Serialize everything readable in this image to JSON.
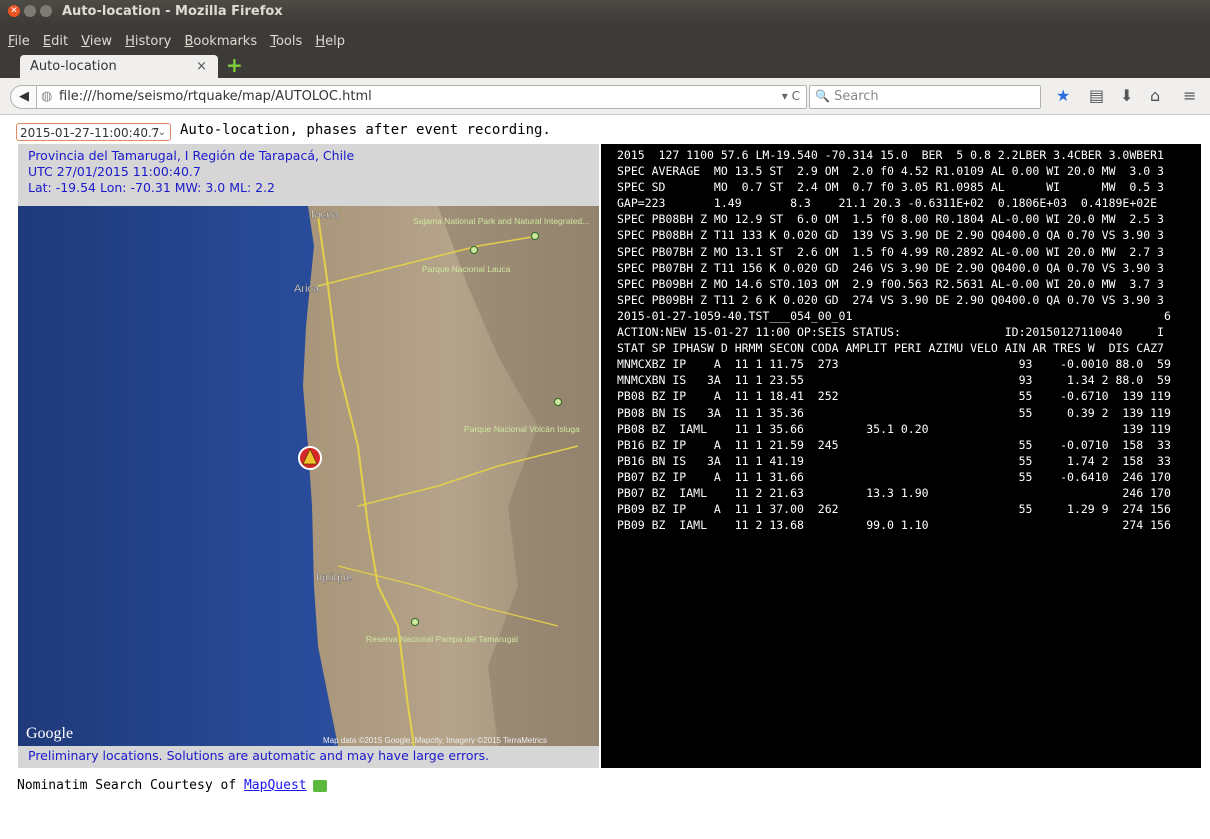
{
  "window": {
    "title": "Auto-location - Mozilla Firefox"
  },
  "menu": [
    "File",
    "Edit",
    "View",
    "History",
    "Bookmarks",
    "Tools",
    "Help"
  ],
  "tab": {
    "label": "Auto-location",
    "close": "×",
    "new_tab": "+"
  },
  "nav": {
    "back": "◀",
    "url": "file:///home/seismo/rtquake/map/AUTOLOC.html",
    "reload": "▾ C",
    "search_placeholder": "Search"
  },
  "toolbar_icons": [
    "star-icon",
    "reading-list-icon",
    "download-icon",
    "home-icon",
    "menu-icon"
  ],
  "page": {
    "event_selector": "2015-01-27-11:00:40.7",
    "heading": "Auto-location, phases after event recording.",
    "info_lines": [
      "Provincia del Tamarugal, I Región de Tarapacá, Chile",
      "UTC 27/01/2015 11:00:40.7",
      "Lat: -19.54 Lon: -70.31 MW: 3.0 ML: 2.2"
    ],
    "map_labels": {
      "tacna": "Tacna",
      "arica": "Arica",
      "iquique": "Iquique",
      "sajama": "Sajama National Park and Natural Integrated...",
      "lauca": "Parque Nacional Lauca",
      "isluga": "Parque Nacional Volcán Isluga",
      "tamarugal": "Reserva Nacional Pampa del Tamarugal",
      "google": "Google",
      "attribution": "Map data ©2015 Google, Mapcity, Imagery ©2015 TerraMetrics"
    },
    "prelim": "Preliminary locations. Solutions are automatic and may have large errors.",
    "footer_text": "Nominatim Search Courtesy of ",
    "footer_link": "MapQuest"
  },
  "terminal_lines": [
    "2015  127 1100 57.6 LM-19.540 -70.314 15.0  BER  5 0.8 2.2LBER 3.4CBER 3.0WBER1",
    "SPEC AVERAGE  MO 13.5 ST  2.9 OM  2.0 f0 4.52 R1.0109 AL 0.00 WI 20.0 MW  3.0 3",
    "SPEC SD       MO  0.7 ST  2.4 OM  0.7 f0 3.05 R1.0985 AL      WI      MW  0.5 3",
    "GAP=223       1.49       8.3    21.1 20.3 -0.6311E+02  0.1806E+03  0.4189E+02E",
    "SPEC PB08BH Z MO 12.9 ST  6.0 OM  1.5 f0 8.00 R0.1804 AL-0.00 WI 20.0 MW  2.5 3",
    "SPEC PB08BH Z T11 133 K 0.020 GD  139 VS 3.90 DE 2.90 Q0400.0 QA 0.70 VS 3.90 3",
    "SPEC PB07BH Z MO 13.1 ST  2.6 OM  1.5 f0 4.99 R0.2892 AL-0.00 WI 20.0 MW  2.7 3",
    "SPEC PB07BH Z T11 156 K 0.020 GD  246 VS 3.90 DE 2.90 Q0400.0 QA 0.70 VS 3.90 3",
    "SPEC PB09BH Z MO 14.6 ST0.103 OM  2.9 f00.563 R2.5631 AL-0.00 WI 20.0 MW  3.7 3",
    "SPEC PB09BH Z T11 2 6 K 0.020 GD  274 VS 3.90 DE 2.90 Q0400.0 QA 0.70 VS 3.90 3",
    "2015-01-27-1059-40.TST___054_00_01                                             6",
    "ACTION:NEW 15-01-27 11:00 OP:SEIS STATUS:               ID:20150127110040     I",
    "STAT SP IPHASW D HRMM SECON CODA AMPLIT PERI AZIMU VELO AIN AR TRES W  DIS CAZ7",
    "MNMCXBZ IP    A  11 1 11.75  273                          93    -0.0010 88.0  59",
    "MNMCXBN IS   3A  11 1 23.55                               93     1.34 2 88.0  59",
    "PB08 BZ IP    A  11 1 18.41  252                          55    -0.6710  139 119",
    "PB08 BN IS   3A  11 1 35.36                               55     0.39 2  139 119",
    "PB08 BZ  IAML    11 1 35.66         35.1 0.20                            139 119",
    "PB16 BZ IP    A  11 1 21.59  245                          55    -0.0710  158  33",
    "PB16 BN IS   3A  11 1 41.19                               55     1.74 2  158  33",
    "PB07 BZ IP    A  11 1 31.66                               55    -0.6410  246 170",
    "PB07 BZ  IAML    11 2 21.63         13.3 1.90                            246 170",
    "PB09 BZ IP    A  11 1 37.00  262                          55     1.29 9  274 156",
    "PB09 BZ  IAML    11 2 13.68         99.0 1.10                            274 156"
  ]
}
